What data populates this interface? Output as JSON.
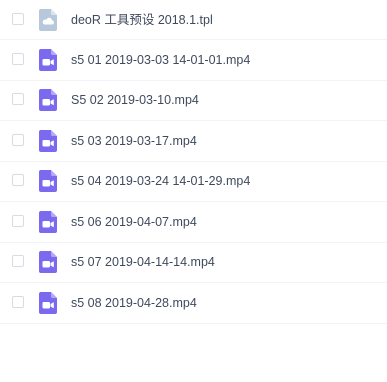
{
  "files": [
    {
      "name": "deoR 工具预设 2018.1.tpl",
      "icon": "cloud-file-icon",
      "icon_color": "#b7c8da"
    },
    {
      "name": "s5 01 2019-03-03 14-01-01.mp4",
      "icon": "video-file-icon",
      "icon_color": "#7b6af0"
    },
    {
      "name": "S5 02 2019-03-10.mp4",
      "icon": "video-file-icon",
      "icon_color": "#7b6af0"
    },
    {
      "name": "s5 03 2019-03-17.mp4",
      "icon": "video-file-icon",
      "icon_color": "#7b6af0"
    },
    {
      "name": "s5 04 2019-03-24 14-01-29.mp4",
      "icon": "video-file-icon",
      "icon_color": "#7b6af0"
    },
    {
      "name": "s5 06 2019-04-07.mp4",
      "icon": "video-file-icon",
      "icon_color": "#7b6af0"
    },
    {
      "name": "s5 07 2019-04-14-14.mp4",
      "icon": "video-file-icon",
      "icon_color": "#7b6af0"
    },
    {
      "name": "s5 08 2019-04-28.mp4",
      "icon": "video-file-icon",
      "icon_color": "#7b6af0"
    }
  ]
}
